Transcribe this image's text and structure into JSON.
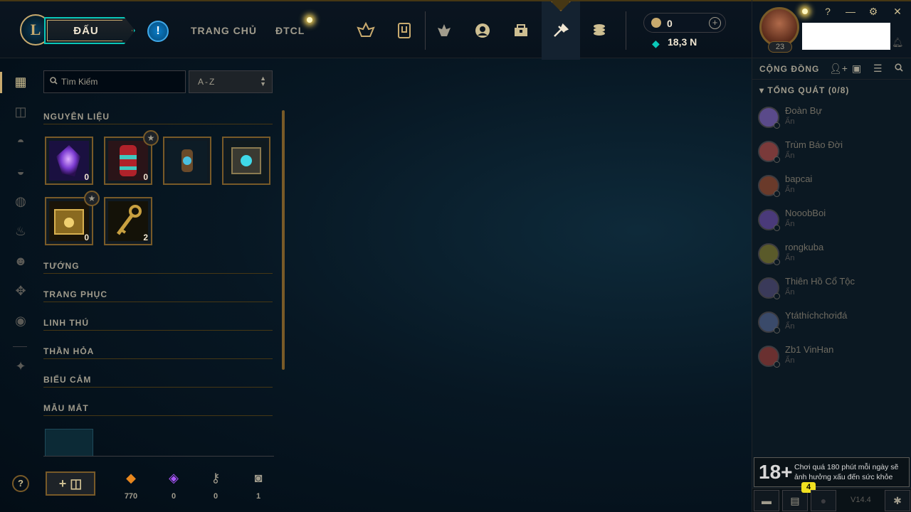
{
  "header": {
    "logo_letter": "L",
    "play_label": "ĐẤU",
    "alert_symbol": "!",
    "nav_links": [
      "TRANG CHỦ",
      "ĐTCL"
    ],
    "nav_icons": [
      "ranked-emblem-icon",
      "collection-icon",
      "tft-icon",
      "profile-icon",
      "loot-icon",
      "crafting-icon",
      "store-icon"
    ],
    "rp_value": "0",
    "blue_essence_value": "18,3 N"
  },
  "profile": {
    "level": "23",
    "window_controls": [
      "?",
      "—",
      "⚙",
      "✕"
    ]
  },
  "social": {
    "title": "CỘNG ĐỒNG",
    "group_label": "TỔNG QUÁT (0/8)",
    "friends": [
      {
        "name": "Đoàn Bự",
        "status": "Ẩn",
        "color": "#5a4a8a"
      },
      {
        "name": "Trùm Báo Đời",
        "status": "Ẩn",
        "color": "#7a3a3a"
      },
      {
        "name": "bapcai",
        "status": "Ẩn",
        "color": "#6a3a2a"
      },
      {
        "name": "NooobBoi",
        "status": "Ẩn",
        "color": "#4a3a7a"
      },
      {
        "name": "rongkuba",
        "status": "Ẩn",
        "color": "#5a5a2a"
      },
      {
        "name": "Thiên Hồ Cổ Tộc",
        "status": "Ẩn",
        "color": "#3a3a5a"
      },
      {
        "name": "Ytáthíchchơiđá",
        "status": "Ẩn",
        "color": "#3a4a6a"
      },
      {
        "name": "Zb1 VinHan",
        "status": "Ẩn",
        "color": "#6a3030"
      }
    ],
    "rating_age": "18+",
    "rating_text": "Chơi quá 180 phút mỗi ngày sẽ ảnh hưởng xấu đến sức khỏe",
    "chat_badge": "4",
    "version": "V14.4"
  },
  "collection": {
    "search_placeholder": "Tìm Kiếm",
    "sort_label": "A-Z",
    "sections": [
      "NGUYÊN LIỆU",
      "TƯỚNG",
      "TRANG PHỤC",
      "LINH THÚ",
      "THẦN HỎA",
      "BIỂU CẢM",
      "MẪU MẮT"
    ],
    "materials": [
      {
        "name": "gemstone",
        "count": "0",
        "starred": false
      },
      {
        "name": "capsule",
        "count": "0",
        "starred": true
      },
      {
        "name": "orb-capsule",
        "count": "",
        "starred": false
      },
      {
        "name": "hextech-chest",
        "count": "",
        "starred": false
      },
      {
        "name": "masterwork-chest",
        "count": "0",
        "starred": true
      },
      {
        "name": "key",
        "count": "2",
        "starred": false
      }
    ],
    "footer_currencies": [
      {
        "icon": "orange-essence-icon",
        "glyph": "◆",
        "value": "770",
        "color": "#e8871e"
      },
      {
        "icon": "mythic-essence-icon",
        "glyph": "◈",
        "value": "0",
        "color": "#a855f7"
      },
      {
        "icon": "key-fragment-icon",
        "glyph": "⚷",
        "value": "0",
        "color": "#a09b8c"
      },
      {
        "icon": "chest-icon",
        "glyph": "◙",
        "value": "1",
        "color": "#a09b8c"
      }
    ],
    "craft_label": "+"
  }
}
